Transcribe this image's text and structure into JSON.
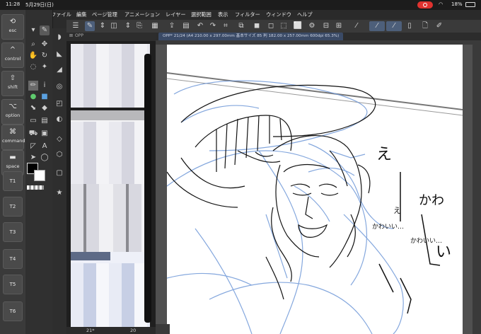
{
  "status": {
    "time": "11:28",
    "date": "5月29日(日)",
    "battery": "18%"
  },
  "menu": [
    "ファイル",
    "編集",
    "ページ管理",
    "アニメーション",
    "レイヤー",
    "選択範囲",
    "表示",
    "フィルター",
    "ウィンドウ",
    "ヘルプ"
  ],
  "keys": [
    {
      "sym": "⟲",
      "label": "esc"
    },
    {
      "sym": "^",
      "label": "control"
    },
    {
      "sym": "⇧",
      "label": "shift"
    },
    {
      "sym": "⌥",
      "label": "option"
    },
    {
      "sym": "⌘",
      "label": "command"
    },
    {
      "sym": "▬",
      "label": "space"
    }
  ],
  "tkeys": [
    "T1",
    "T2",
    "T3",
    "T4",
    "T5",
    "T6"
  ],
  "pages_header": "OPP",
  "canvas_tab": "OPP* 21/24 (A4 210.00 x 297.00mm 基本サイズ 85 判 182.00 x 257.00mm 600dpi 65.3%)",
  "page_numbers": {
    "left": "21*",
    "right": "20"
  },
  "manga_text": [
    "え",
    "かわ",
    "い",
    "かわいい…",
    "かわいい…",
    "え"
  ],
  "icons": {
    "tools": [
      "pen-icon",
      "brush-icon",
      "eraser-icon",
      "fill-icon",
      "select-icon",
      "move-icon",
      "text-icon",
      "gradient-icon",
      "figure-icon",
      "eyedropper-icon",
      "lasso-icon",
      "zoom-icon"
    ]
  },
  "colors": {
    "accent": "#4d5f7a",
    "sketch_blue": "#6f98d8",
    "record": "#e0322f"
  }
}
